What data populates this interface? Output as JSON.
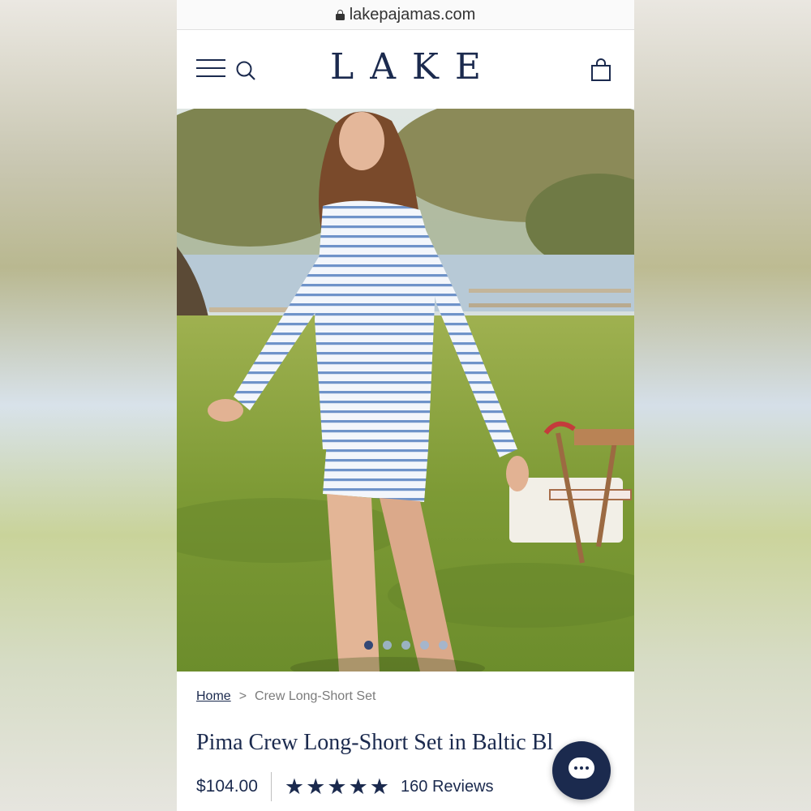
{
  "browser": {
    "url": "lakepajamas.com"
  },
  "header": {
    "logo": "LAKE"
  },
  "hero": {
    "slide_count": 5,
    "active_slide": 1
  },
  "breadcrumb": {
    "home": "Home",
    "separator": ">",
    "current": "Crew Long-Short Set"
  },
  "product": {
    "title": "Pima Crew Long-Short Set in Baltic Bl",
    "price": "$104.00",
    "rating_stars": 5,
    "reviews": "160 Reviews"
  },
  "icons": [
    "lock-icon",
    "menu-icon",
    "search-icon",
    "shopping-bag-icon",
    "star-icon",
    "chat-icon"
  ],
  "colors": {
    "brand_navy": "#1b2a4e",
    "dot_inactive": "#9fb6d1",
    "dot_active": "#1f3c72"
  }
}
